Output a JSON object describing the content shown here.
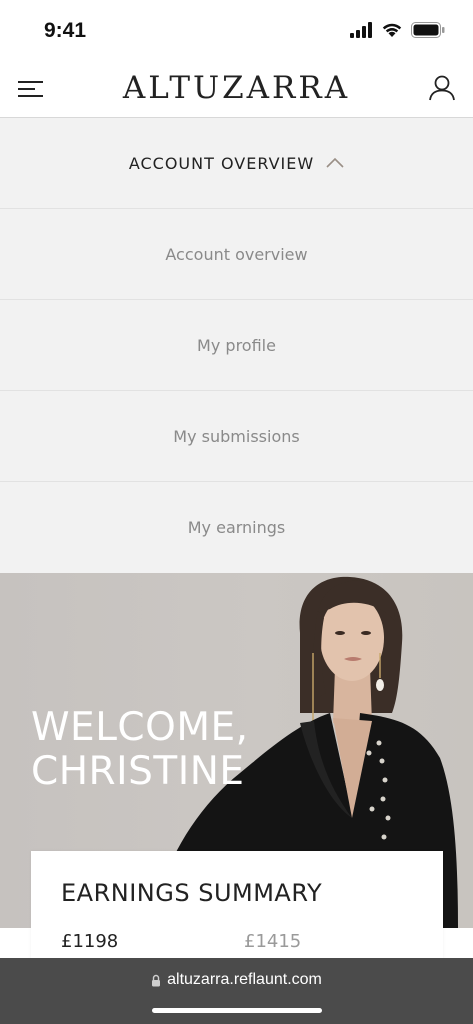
{
  "status_bar": {
    "time": "9:41"
  },
  "header": {
    "brand": "ALTUZARRA",
    "menu_icon": "hamburger-menu-icon",
    "account_icon": "user-icon"
  },
  "account_menu": {
    "title": "ACCOUNT OVERVIEW",
    "items": [
      {
        "label": "Account overview"
      },
      {
        "label": "My profile"
      },
      {
        "label": "My submissions"
      },
      {
        "label": "My earnings"
      }
    ]
  },
  "hero": {
    "welcome_line1": "WELCOME,",
    "welcome_line2": "CHRISTINE"
  },
  "earnings": {
    "title": "EARNINGS SUMMARY",
    "value_primary": "£1198",
    "value_secondary": "£1415"
  },
  "browser": {
    "url": "altuzarra.reflaunt.com",
    "lock_icon": "lock-icon"
  },
  "colors": {
    "menu_background": "#f2f2f2",
    "url_bar": "#4b4b4b",
    "hero_background": "#c8c4c0"
  }
}
